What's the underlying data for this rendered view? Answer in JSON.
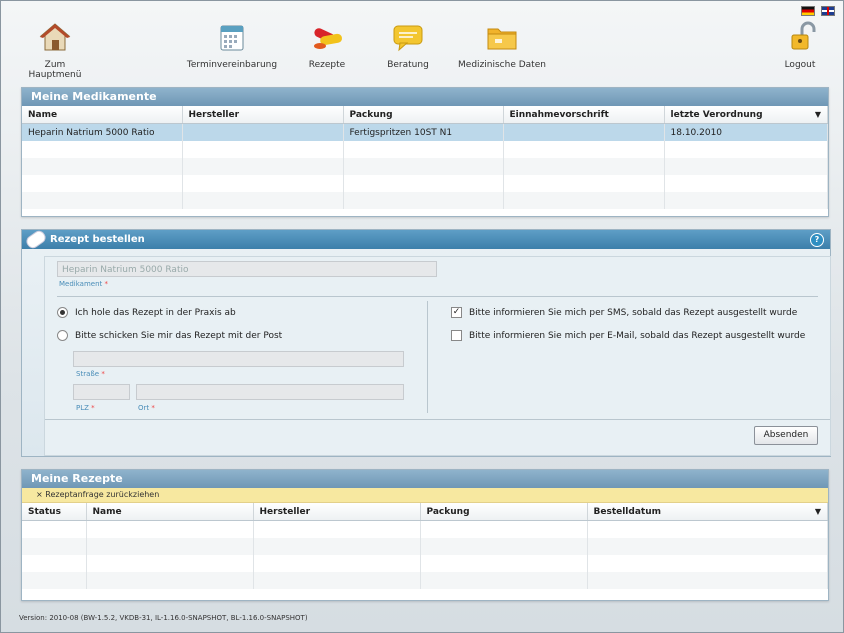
{
  "nav": {
    "home": "Zum Hauptmenü",
    "appointments": "Terminvereinbarung",
    "prescriptions": "Rezepte",
    "consulting": "Beratung",
    "medical_data": "Medizinische Daten",
    "logout": "Logout"
  },
  "medications": {
    "title": "Meine Medikamente",
    "columns": [
      "Name",
      "Hersteller",
      "Packung",
      "Einnahmevorschrift",
      "letzte Verordnung"
    ],
    "rows": [
      [
        "Heparin Natrium 5000 Ratio",
        "",
        "Fertigspritzen 10ST N1",
        "",
        "18.10.2010"
      ]
    ]
  },
  "order": {
    "title": "Rezept bestellen",
    "medication_value": "Heparin Natrium 5000 Ratio",
    "medication_label": "Medikament",
    "required": "*",
    "pickup_option": "Ich hole das Rezept in der Praxis ab",
    "mail_option": "Bitte schicken Sie mir das Rezept mit der Post",
    "street_label": "Straße",
    "zip_label": "PLZ",
    "city_label": "Ort",
    "sms_option": "Bitte informieren Sie mich per SMS, sobald das Rezept ausgestellt wurde",
    "email_option": "Bitte informieren Sie mich per E-Mail, sobald das Rezept ausgestellt wurde",
    "submit": "Absenden",
    "help": "?"
  },
  "prescriptions": {
    "title": "Meine Rezepte",
    "withdraw": "Rezeptanfrage zurückziehen",
    "columns": [
      "Status",
      "Name",
      "Hersteller",
      "Packung",
      "Bestelldatum"
    ]
  },
  "footer": {
    "version": "Version: 2010-08 (BW-1.5.2, VKDB-31, IL-1.16.0-SNAPSHOT, BL-1.16.0-SNAPSHOT)"
  }
}
